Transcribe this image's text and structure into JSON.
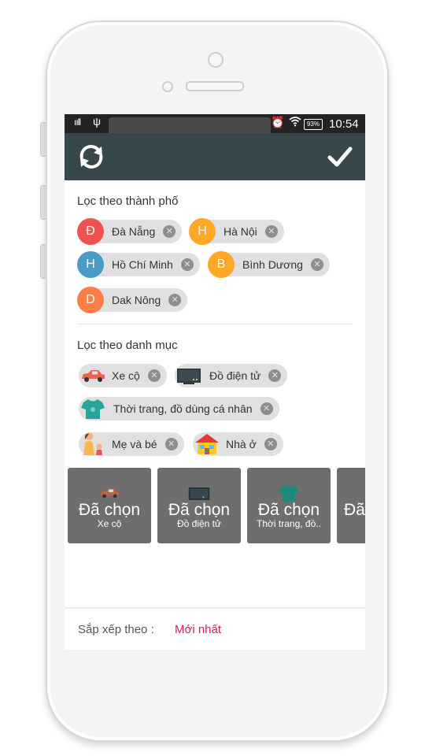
{
  "status_bar": {
    "signal": "ııll",
    "usb_icon": "usb-icon",
    "alarm_icon": "alarm-icon",
    "wifi_icon": "wifi-icon",
    "battery": "93%",
    "time": "10:54"
  },
  "toolbar": {
    "refresh_icon": "refresh-icon",
    "confirm_icon": "check-icon",
    "background": "#37474c"
  },
  "city_filter": {
    "title": "Lọc theo thành phố",
    "items": [
      {
        "initial": "Đ",
        "label": "Đà Nẵng",
        "color": "#ef5350"
      },
      {
        "initial": "H",
        "label": "Hà Nội",
        "color": "#ffa726"
      },
      {
        "initial": "H",
        "label": "Hồ Chí Minh",
        "color": "#4a9cc7"
      },
      {
        "initial": "B",
        "label": "Bình Dương",
        "color": "#ffa726"
      },
      {
        "initial": "D",
        "label": "Dak Nông",
        "color": "#ff7e47"
      }
    ]
  },
  "category_filter": {
    "title": "Lọc theo danh mục",
    "items": [
      {
        "icon": "car-icon",
        "label": "Xe cộ"
      },
      {
        "icon": "electronics-icon",
        "label": "Đồ điện tử"
      },
      {
        "icon": "shirt-icon",
        "label": "Thời trang, đồ dùng cá nhân"
      },
      {
        "icon": "mother-baby-icon",
        "label": "Mẹ và bé"
      },
      {
        "icon": "house-icon",
        "label": "Nhà ở"
      }
    ]
  },
  "selected_cards": [
    {
      "status": "Đã chọn",
      "name": "Xe cộ",
      "icon": "car-icon"
    },
    {
      "status": "Đã chọn",
      "name": "Đồ điện tử",
      "icon": "electronics-icon"
    },
    {
      "status": "Đã chọn",
      "name": "Thời trang, đồ..",
      "icon": "shirt-icon"
    },
    {
      "status": "Đã",
      "name": "",
      "icon": ""
    }
  ],
  "sort": {
    "label": "Sắp xếp theo :",
    "value": "Mới nhất",
    "accent": "#d81b60"
  }
}
